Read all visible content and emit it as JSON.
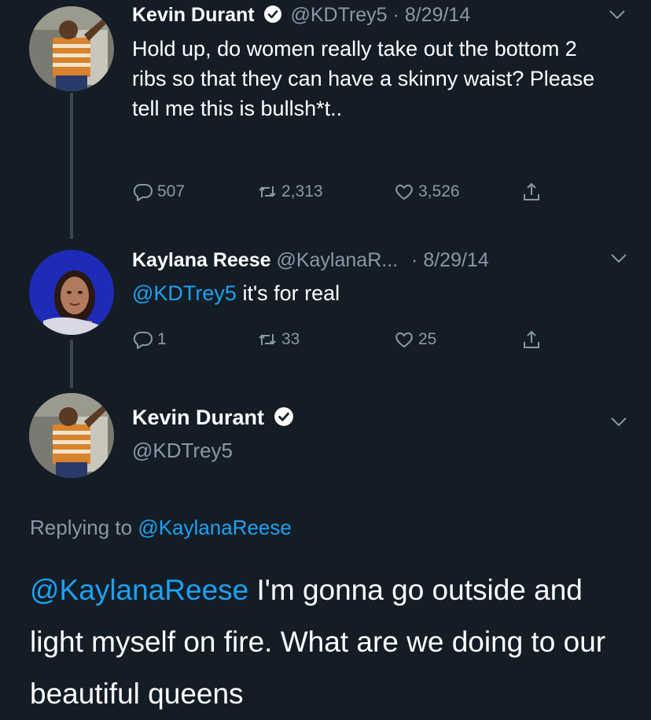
{
  "tweet1": {
    "name": "Kevin Durant",
    "handle": "@KDTrey5",
    "sep": "·",
    "date": "8/29/14",
    "text": "Hold up, do women really take out the bottom 2 ribs so that they can have a skinny waist? Please tell me this is bullsh*t..",
    "replies": "507",
    "retweets": "2,313",
    "likes": "3,526"
  },
  "tweet2": {
    "name": "Kaylana Reese",
    "handle": "@KaylanaR...",
    "sep": "·",
    "date": "8/29/14",
    "mention": "@KDTrey5",
    "text": " it's for real",
    "replies": "1",
    "retweets": "33",
    "likes": "25"
  },
  "main_tweet": {
    "name": "Kevin Durant",
    "handle": "@KDTrey5",
    "replying_prefix": "Replying to ",
    "replying_to": "@KaylanaReese",
    "mention": "@KaylanaReese",
    "text": " I'm gonna go outside and light myself on fire. What are we doing to our beautiful queens"
  },
  "icons": {
    "verified": "verified-badge-icon",
    "reply": "reply-icon",
    "retweet": "retweet-icon",
    "like": "heart-icon",
    "share": "share-icon",
    "chevron": "chevron-down-icon"
  },
  "colors": {
    "background": "#141d26",
    "accent": "#1da1f2",
    "secondary_text": "#8899a6",
    "primary_text": "#ffffff"
  }
}
